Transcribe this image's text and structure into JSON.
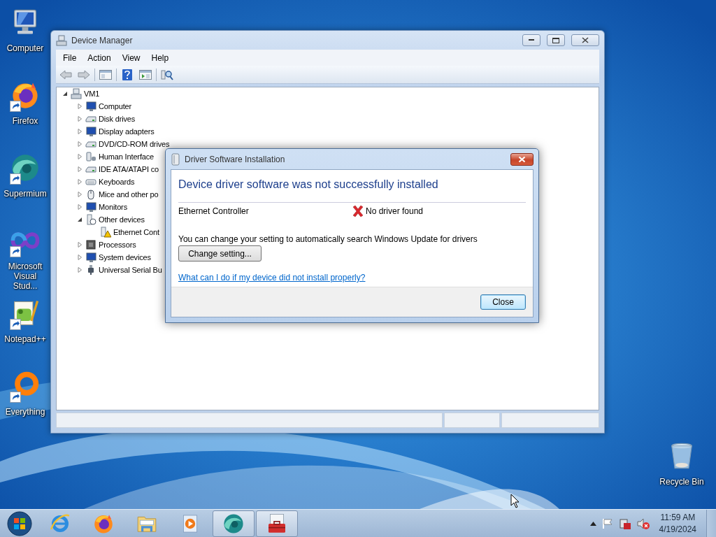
{
  "desktop_icons": [
    {
      "label": "Computer",
      "kind": "computer",
      "shortcut": false
    },
    {
      "label": "Firefox",
      "kind": "fox",
      "shortcut": true
    },
    {
      "label": "Supermium",
      "kind": "swirl",
      "shortcut": true
    },
    {
      "label": "Microsoft Visual Stud...",
      "kind": "infinity",
      "shortcut": true
    },
    {
      "label": "Notepad++",
      "kind": "notepad",
      "shortcut": true
    },
    {
      "label": "Everything",
      "kind": "ring",
      "shortcut": true
    }
  ],
  "recycle_bin": {
    "label": "Recycle Bin"
  },
  "device_manager": {
    "title": "Device Manager",
    "menu": [
      "File",
      "Action",
      "View",
      "Help"
    ],
    "tree": {
      "label": "VM1",
      "kind": "host",
      "expanded": true,
      "children": [
        {
          "label": "Computer",
          "kind": "monitor",
          "expanded": false
        },
        {
          "label": "Disk drives",
          "kind": "drive",
          "expanded": false
        },
        {
          "label": "Display adapters",
          "kind": "monitor",
          "expanded": false
        },
        {
          "label": "DVD/CD-ROM drives",
          "kind": "drive",
          "expanded": false
        },
        {
          "label": "Human Interface",
          "kind": "device",
          "expanded": false
        },
        {
          "label": "IDE ATA/ATAPI co",
          "kind": "drive",
          "expanded": false
        },
        {
          "label": "Keyboards",
          "kind": "keyboard",
          "expanded": false
        },
        {
          "label": "Mice and other po",
          "kind": "mouse",
          "expanded": false
        },
        {
          "label": "Monitors",
          "kind": "monitor",
          "expanded": false
        },
        {
          "label": "Other devices",
          "kind": "unknown",
          "expanded": true,
          "children": [
            {
              "label": "Ethernet Cont",
              "kind": "warning"
            }
          ]
        },
        {
          "label": "Processors",
          "kind": "chip",
          "expanded": false
        },
        {
          "label": "System devices",
          "kind": "monitor",
          "expanded": false
        },
        {
          "label": "Universal Serial Bu",
          "kind": "plug",
          "expanded": false
        }
      ]
    }
  },
  "dialog": {
    "title": "Driver Software Installation",
    "heading": "Device driver software was not successfully installed",
    "device": "Ethernet Controller",
    "status": "No driver found",
    "message": "You can change your setting to automatically search Windows Update for drivers",
    "change_button": "Change setting...",
    "help_link": "What can I do if my device did not install properly?",
    "close_button": "Close"
  },
  "taskbar": {
    "items": [
      {
        "kind": "browser",
        "open": false
      },
      {
        "kind": "fox",
        "open": false
      },
      {
        "kind": "folder",
        "open": false
      },
      {
        "kind": "media",
        "open": false
      },
      {
        "kind": "swirl",
        "open": true
      },
      {
        "kind": "toolbox",
        "open": true
      }
    ],
    "time": "11:59 AM",
    "date": "4/19/2024"
  }
}
